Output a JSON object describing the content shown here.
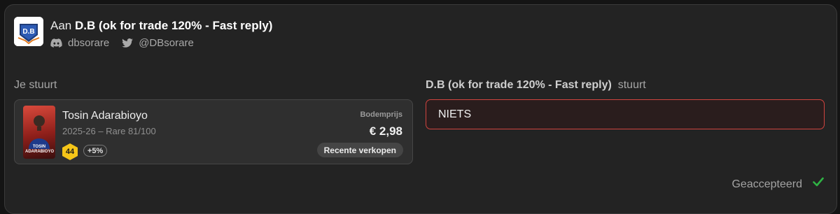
{
  "header": {
    "prefix": "Aan",
    "name": "D.B (ok for trade 120% - Fast reply)",
    "avatar_text": "D.B",
    "discord_handle": "dbsorare",
    "twitter_handle": "@DBsorare"
  },
  "left": {
    "label": "Je stuurt",
    "card": {
      "player_name": "Tosin Adarabioyo",
      "meta": "2025-26 – Rare 81/100",
      "thumb_name": "TOSIN ADARABIOYO",
      "score": "44",
      "bonus": "+5%",
      "floor_label": "Bodemprijs",
      "price": "€ 2,98",
      "recent_sales_label": "Recente verkopen"
    }
  },
  "right": {
    "name": "D.B (ok for trade 120% - Fast reply)",
    "suffix": "stuurt",
    "nothing_text": "NIETS"
  },
  "status": {
    "text": "Geaccepteerd"
  },
  "colors": {
    "accent_red": "#d0443f",
    "accept_green": "#2fb344",
    "score_yellow": "#f5c518"
  }
}
